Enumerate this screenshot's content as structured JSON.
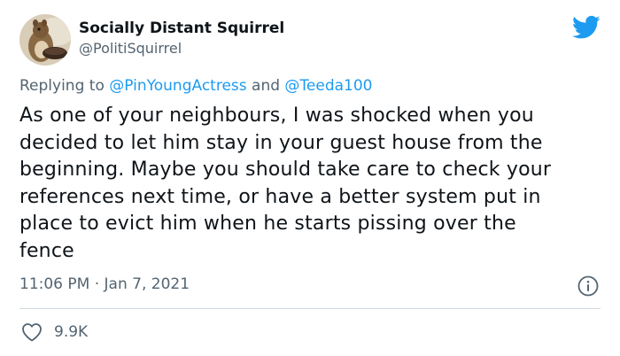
{
  "author": {
    "display_name": "Socially Distant Squirrel",
    "handle": "@PolitiSquirrel",
    "avatar_icon": "squirrel-avatar"
  },
  "platform_icon": "twitter-bird-icon",
  "reply": {
    "prefix": "Replying to",
    "mentions": [
      "@PinYoungActress",
      "@Teeda100"
    ],
    "joiner": "and"
  },
  "tweet": {
    "lines": [
      "As one of your neighbours, I was shocked when you",
      "decided to let him stay in your guest house from the",
      "beginning.  Maybe you should take care to check your",
      "references next time, or have a better system put in",
      "place to evict him when he starts pissing over the",
      "fence"
    ],
    "timestamp": "11:06 PM · Jan 7, 2021"
  },
  "stats": {
    "likes": "9.9K"
  },
  "colors": {
    "accent": "#1d9bf0",
    "secondary_text": "#536471",
    "divider": "#cfd9de"
  }
}
